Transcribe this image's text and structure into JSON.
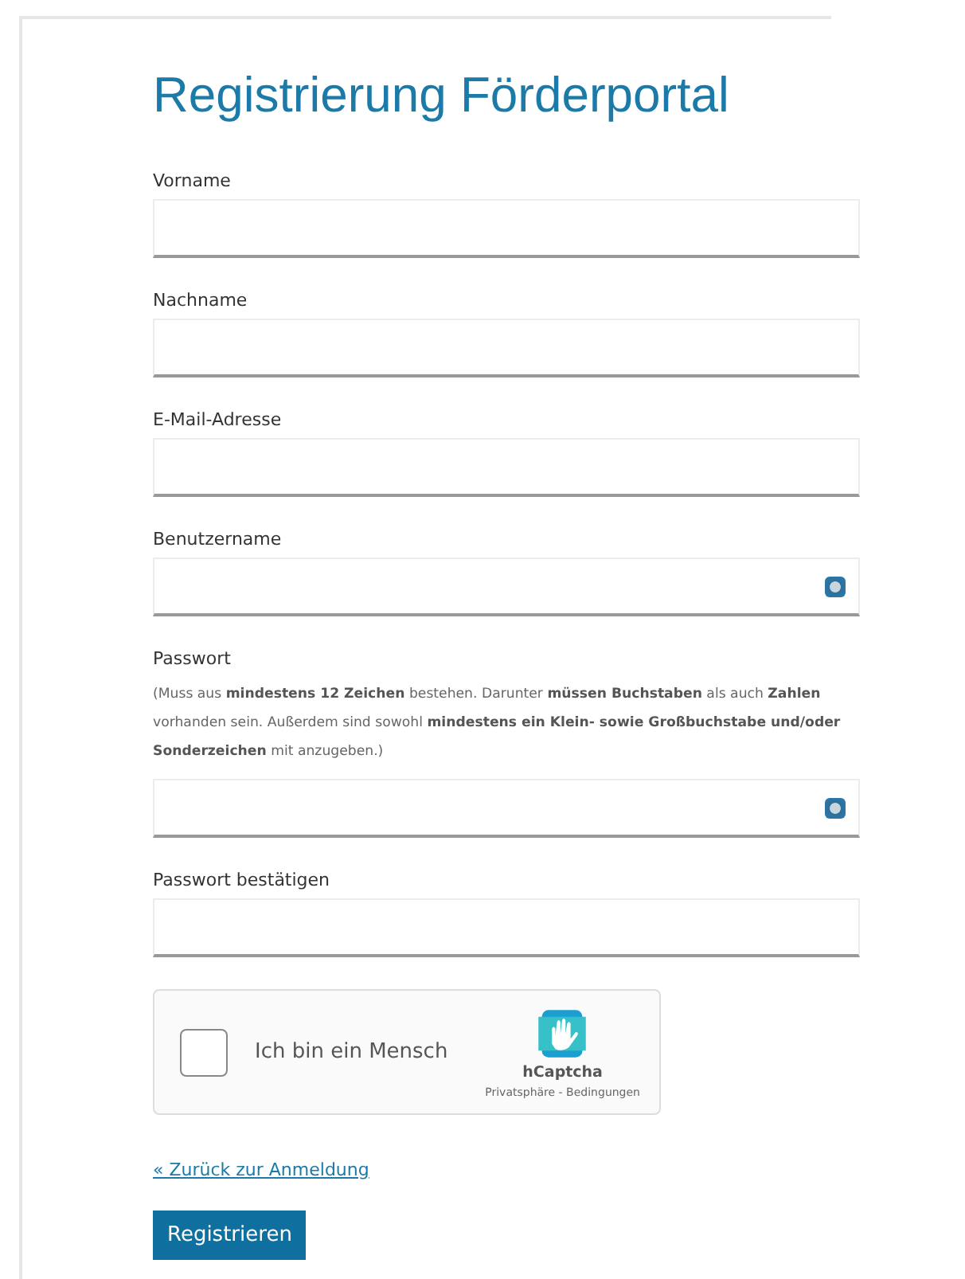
{
  "title": "Registrierung Förderportal",
  "fields": [
    {
      "label": "Vorname",
      "has_icon": false
    },
    {
      "label": "Nachname",
      "has_icon": false
    },
    {
      "label": "E-Mail-Adresse",
      "has_icon": false
    },
    {
      "label": "Benutzername",
      "has_icon": true
    },
    {
      "label": "Passwort",
      "hint": "(Muss aus **mindestens 12 Zeichen** bestehen. Darunter **müssen Buchstaben** als auch **Zahlen** vorhanden sein. Außerdem sind sowohl **mindestens ein Klein- sowie Großbuchstabe und/oder Sonderzeichen** mit anzugeben.)",
      "has_icon": true
    },
    {
      "label": "Passwort bestätigen",
      "has_icon": false
    }
  ],
  "captcha": {
    "label": "Ich bin ein Mensch",
    "checked": false,
    "brand": "hCaptcha",
    "links": "Privatsphäre - Bedingungen"
  },
  "back_link": "« Zurück zur Anmeldung",
  "submit": "Registrieren"
}
